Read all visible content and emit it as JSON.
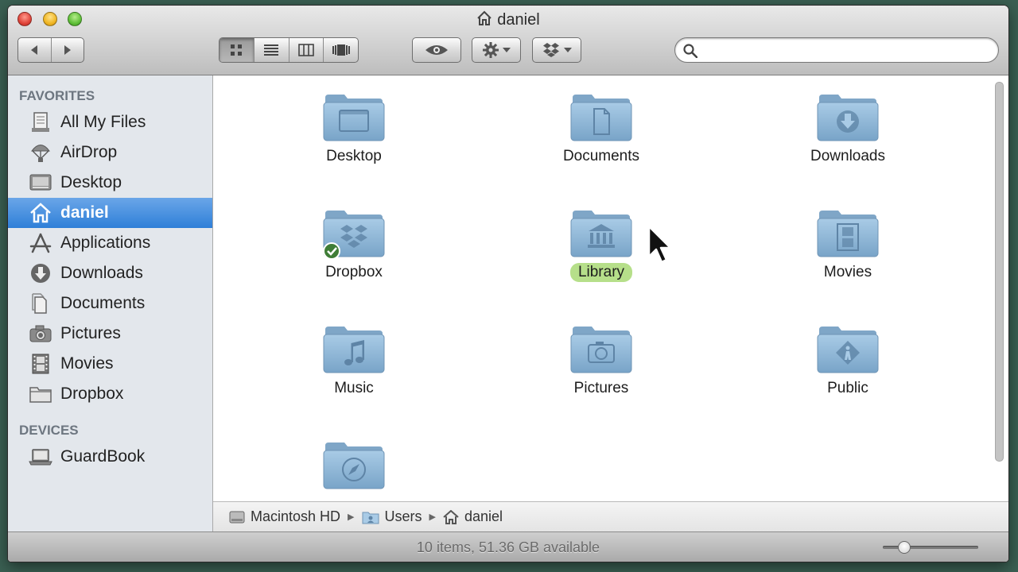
{
  "window": {
    "title": "daniel"
  },
  "toolbar": {
    "back_icon": "back-arrow-icon",
    "forward_icon": "forward-arrow-icon",
    "view_modes": [
      "icon-view",
      "list-view",
      "column-view",
      "coverflow-view"
    ],
    "active_view": "icon-view",
    "search": {
      "placeholder": "",
      "value": ""
    }
  },
  "sidebar": {
    "favorites_header": "FAVORITES",
    "favorites": [
      {
        "label": "All My Files",
        "icon": "all-files-icon"
      },
      {
        "label": "AirDrop",
        "icon": "airdrop-icon"
      },
      {
        "label": "Desktop",
        "icon": "desktop-icon"
      },
      {
        "label": "daniel",
        "icon": "home-icon",
        "selected": true
      },
      {
        "label": "Applications",
        "icon": "applications-icon"
      },
      {
        "label": "Downloads",
        "icon": "downloads-icon"
      },
      {
        "label": "Documents",
        "icon": "documents-icon"
      },
      {
        "label": "Pictures",
        "icon": "camera-icon"
      },
      {
        "label": "Movies",
        "icon": "film-icon"
      },
      {
        "label": "Dropbox",
        "icon": "folder-icon"
      }
    ],
    "devices_header": "DEVICES",
    "devices": [
      {
        "label": "GuardBook",
        "icon": "laptop-icon"
      }
    ]
  },
  "content": {
    "items": [
      {
        "label": "Desktop",
        "emblem": "desktop"
      },
      {
        "label": "Documents",
        "emblem": "document"
      },
      {
        "label": "Downloads",
        "emblem": "download"
      },
      {
        "label": "Dropbox",
        "emblem": "dropbox",
        "synced": true
      },
      {
        "label": "Library",
        "emblem": "library",
        "highlight": "green"
      },
      {
        "label": "Movies",
        "emblem": "film"
      },
      {
        "label": "Music",
        "emblem": "music"
      },
      {
        "label": "Pictures",
        "emblem": "camera"
      },
      {
        "label": "Public",
        "emblem": "public"
      },
      {
        "label": "",
        "emblem": "sites"
      }
    ]
  },
  "pathbar": {
    "crumbs": [
      {
        "label": "Macintosh HD",
        "icon": "hard-drive-icon"
      },
      {
        "label": "Users",
        "icon": "users-folder-icon"
      },
      {
        "label": "daniel",
        "icon": "home-icon"
      }
    ]
  },
  "status": {
    "text": "10 items, 51.36 GB available",
    "icon_size_slider": 0.18
  },
  "colors": {
    "selection": "#3a86dc",
    "label_green": "#b6df8a",
    "folder_blue": "#8fb6d6"
  }
}
